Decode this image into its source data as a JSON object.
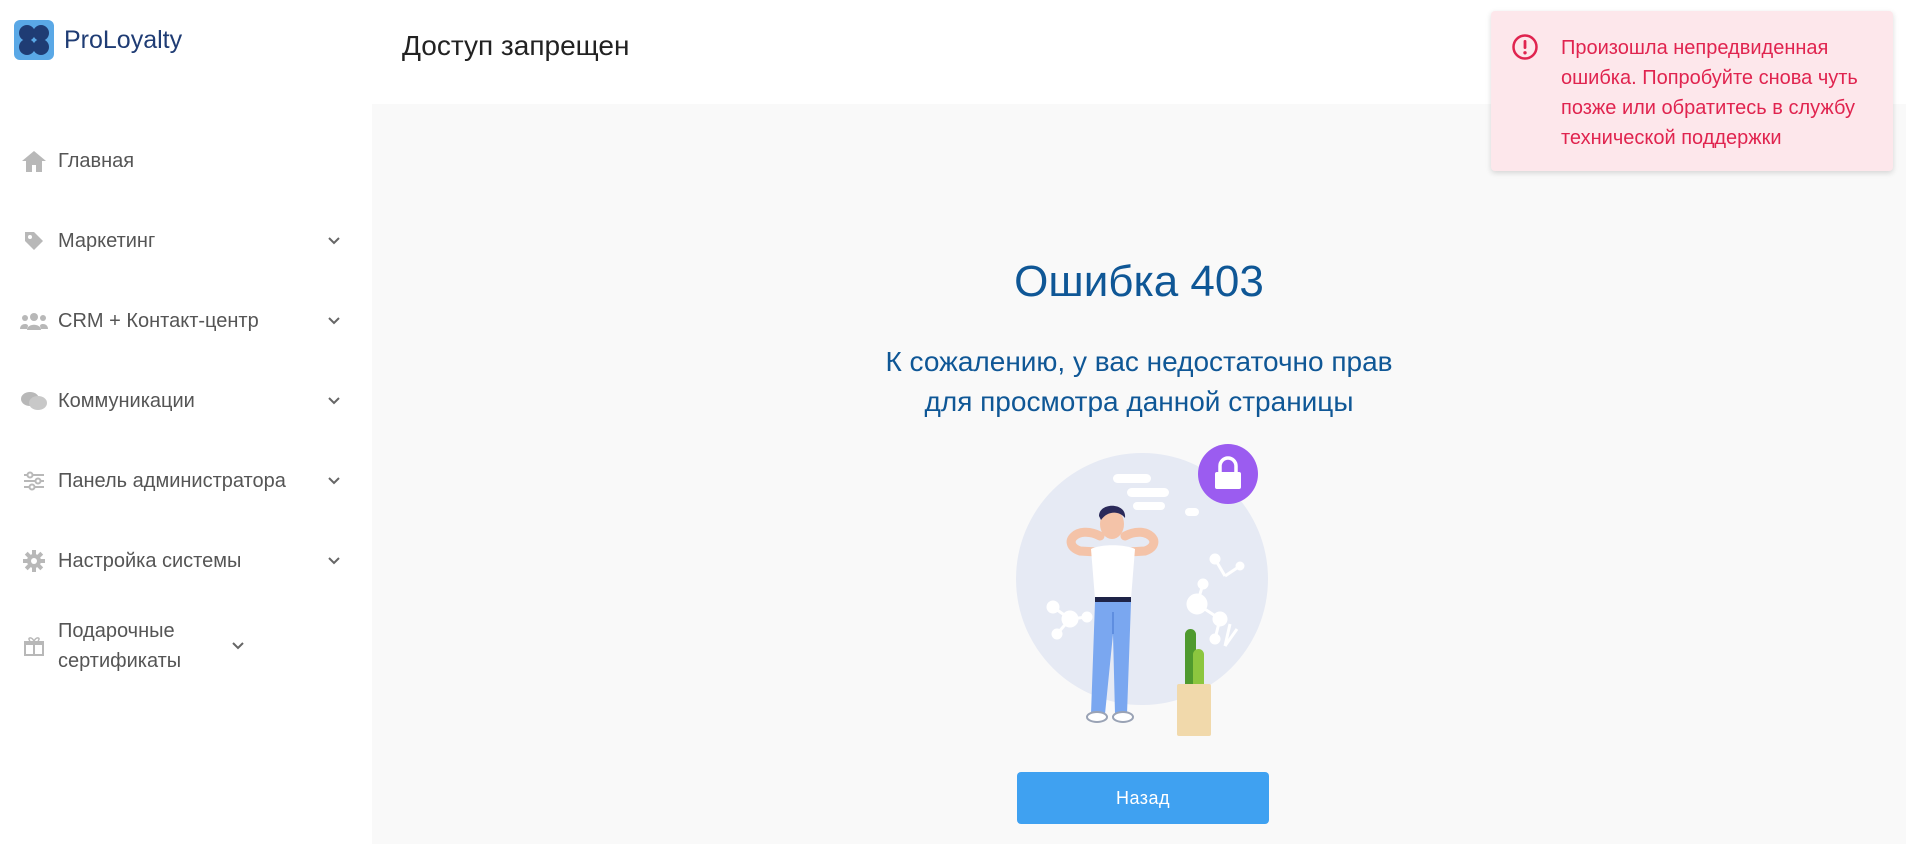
{
  "app": {
    "name": "ProLoyalty",
    "accent": "#3fa1f1",
    "title_color": "#0f5796"
  },
  "sidebar": {
    "items": [
      {
        "label": "Главная",
        "icon": "home-icon",
        "expandable": false
      },
      {
        "label": "Маркетинг",
        "icon": "tag-icon",
        "expandable": true
      },
      {
        "label": "CRM + Контакт-центр",
        "icon": "users-icon",
        "expandable": true
      },
      {
        "label": "Коммуникации",
        "icon": "chat-icon",
        "expandable": true
      },
      {
        "label": "Панель администратора",
        "icon": "sliders-icon",
        "expandable": true
      },
      {
        "label": "Настройка системы",
        "icon": "gear-icon",
        "expandable": true
      },
      {
        "label": "Подарочные сертификаты",
        "icon": "gift-icon",
        "expandable": true
      }
    ]
  },
  "header": {
    "title": "Доступ запрещен"
  },
  "main": {
    "error_title": "Ошибка 403",
    "error_line1": "К сожалению, у вас недостаточно прав",
    "error_line2": "для просмотра данной страницы",
    "illustration": "confused-person-lock-illustration",
    "back_label": "Назад"
  },
  "toast": {
    "type": "error",
    "icon": "alert-circle-icon",
    "message": "Произошла непредвиденная ошибка. Попробуйте снова чуть позже или обратитесь в службу технической поддержки",
    "color": "#e0244f",
    "background": "#fde7eb"
  }
}
